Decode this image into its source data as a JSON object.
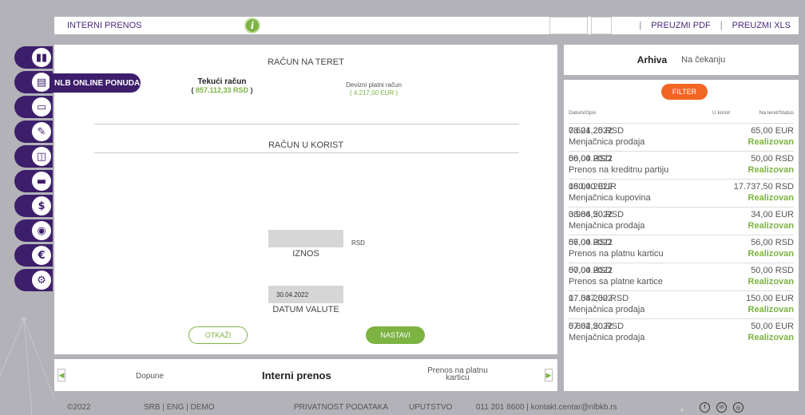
{
  "header": {
    "title": "INTERNI PRENOS",
    "info_icon": "i",
    "download_pdf": "PREUZMI PDF",
    "download_xls": "PREUZMI XLS",
    "separator": "|"
  },
  "sidebar": {
    "tooltip": "NLB ONLINE PONUDA",
    "items": [
      {
        "icon": "chart-icon",
        "glyph": "▮▮"
      },
      {
        "icon": "offer-icon",
        "glyph": "▤"
      },
      {
        "icon": "card-icon",
        "glyph": "▭"
      },
      {
        "icon": "pen-icon",
        "glyph": "✎"
      },
      {
        "icon": "book-icon",
        "glyph": "◫"
      },
      {
        "icon": "minus-card-icon",
        "glyph": "▬"
      },
      {
        "icon": "dollar-icon",
        "glyph": "$"
      },
      {
        "icon": "location-icon",
        "glyph": "◉"
      },
      {
        "icon": "euro-icon",
        "glyph": "€"
      },
      {
        "icon": "settings-icon",
        "glyph": "⚙"
      }
    ]
  },
  "form": {
    "debit_title": "RAČUN NA TERET",
    "account1_name": "Tekući račun",
    "account1_balance_open": "( ",
    "account1_balance": "857.112,33 RSD",
    "account1_balance_close": " )",
    "account2_name": "Devizni platni račun",
    "account2_balance": "( 4.217,00 EUR )",
    "credit_title": "RAČUN U KORIST",
    "currency": "RSD",
    "amount_label": "IZNOS",
    "date_value": "30.04.2022",
    "date_label": "DATUM VALUTE",
    "cancel_label": "OTKAŽI",
    "next_label": "NASTAVI"
  },
  "carousel": {
    "prev_item": "Dopune",
    "active_item": "Interni prenos",
    "next_item": "Prenos na platnu karticu",
    "left_arrow": "◀",
    "right_arrow": "▶"
  },
  "archive": {
    "tab_active": "Arhiva",
    "tab_inactive": "Na čekanju",
    "filter_label": "FILTER",
    "col_date": "Datum/Opis",
    "col_credit": "U korist",
    "col_debit": "Na teret/Status",
    "down_arrow": "▼",
    "transactions": [
      {
        "date": "08.04.2022",
        "desc": "Menjačnica prodaja",
        "amount": "7.621,25 RSD",
        "charge": "65,00 EUR",
        "status": "Realizovan"
      },
      {
        "date": "08.04.2022",
        "desc": "Prenos na kreditnu partiju",
        "amount": "50,00 RSD",
        "charge": "50,00 RSD",
        "status": "Realizovan"
      },
      {
        "date": "08.04.2022",
        "desc": "Menjačnica kupovina",
        "amount": "150,00 EUR",
        "charge": "17.737,50 RSD",
        "status": "Realizovan"
      },
      {
        "date": "08.04.2022",
        "desc": "Menjačnica prodaja",
        "amount": "3.986,50 RSD",
        "charge": "34,00 EUR",
        "status": "Realizovan"
      },
      {
        "date": "07.04.2022",
        "desc": "Prenos na platnu karticu",
        "amount": "56,00 RSD",
        "charge": "56,00 RSD",
        "status": "Realizovan"
      },
      {
        "date": "07.04.2022",
        "desc": "Prenos sa platne kartice",
        "amount": "50,00 RSD",
        "charge": "50,00 RSD",
        "status": "Realizovan"
      },
      {
        "date": "07.04.2022",
        "desc": "Menjačnica prodaja",
        "amount": "17.587,50 RSD",
        "charge": "150,00 EUR",
        "status": "Realizovan"
      },
      {
        "date": "07.04.2022",
        "desc": "Menjačnica prodaja",
        "amount": "5.862,50 RSD",
        "charge": "50,00 EUR",
        "status": "Realizovan"
      }
    ]
  },
  "footer": {
    "copyright": "©2022",
    "lang": "SRB  |  ENG  |  DEMO",
    "privacy": "PRIVATNOST PODATAKA",
    "guide": "UPUTSTVO",
    "contact": "011 201 8600  |  kontakt.centar@nlbkb.rs",
    "facebook": "f",
    "linkedin": "in",
    "instagram": "◎"
  }
}
